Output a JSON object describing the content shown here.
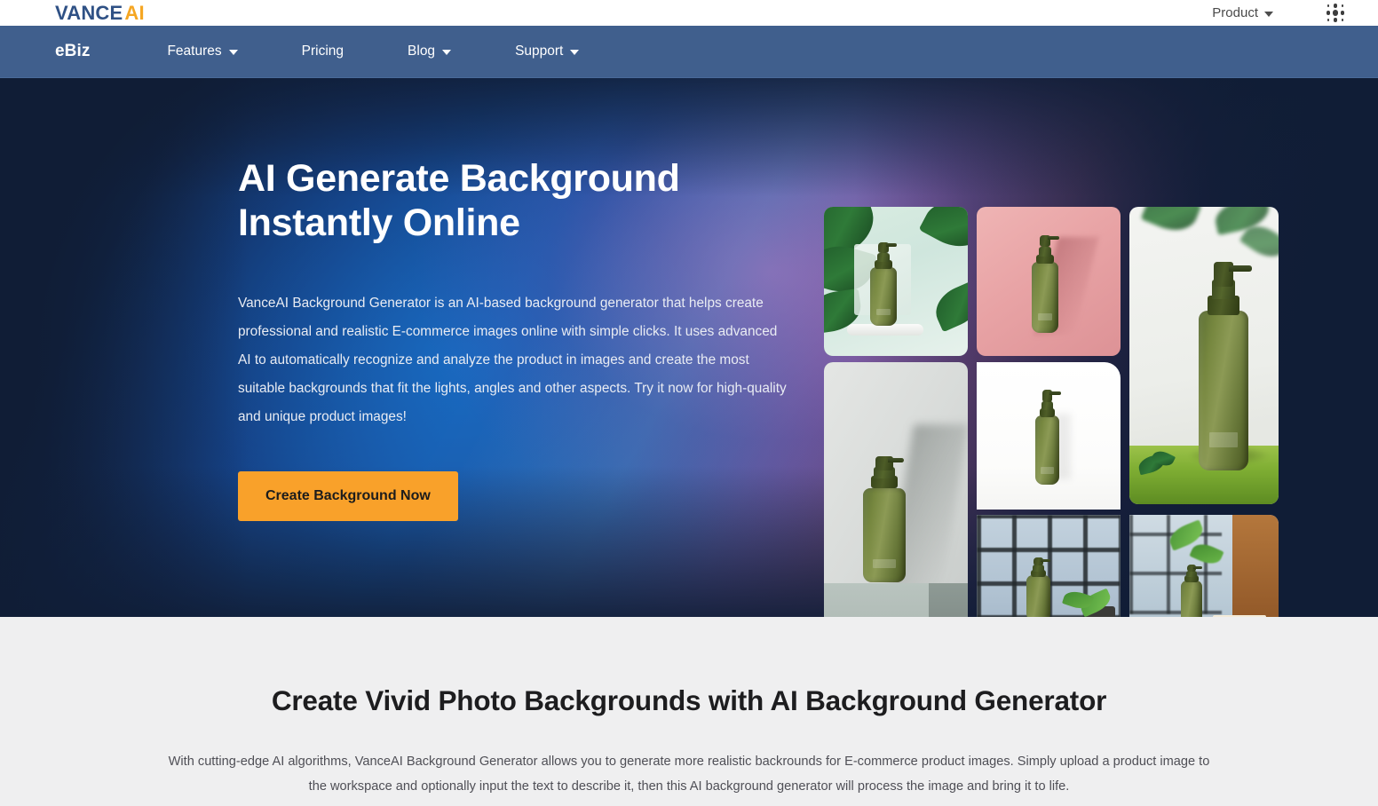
{
  "topbar": {
    "brand": {
      "primary": "VANCE",
      "accent": "AI"
    },
    "product_menu": {
      "label": "Product",
      "caret_icon": "chevron-down-icon"
    },
    "app_launcher_icon": "app-grid-icon"
  },
  "nav": {
    "logo": "eBiz",
    "items": [
      {
        "label": "Features",
        "has_dropdown": true
      },
      {
        "label": "Pricing",
        "has_dropdown": false
      },
      {
        "label": "Blog",
        "has_dropdown": true
      },
      {
        "label": "Support",
        "has_dropdown": true
      }
    ]
  },
  "hero": {
    "title_line1": "AI Generate Background",
    "title_line2": "Instantly Online",
    "description": "VanceAI Background Generator is an AI-based background generator that helps create professional and realistic E-commerce images online with simple clicks. It uses advanced AI to automatically recognize and analyze the product in images and create the most suitable backgrounds that fit the lights, angles and other aspects. Try it now for high-quality and unique product images!",
    "cta_label": "Create Background Now",
    "colors": {
      "background": "#101d36",
      "cta": "#f9a12a",
      "cta_text": "#1c1c1c",
      "beam_blue": "#1c60af",
      "beam_purple": "#9e5c96"
    },
    "gallery": {
      "alt_group": "green pump bottle product photos on generated backgrounds",
      "tiles": [
        {
          "id": "tile-monstera-leaves",
          "background": "mint green with monstera leaves and marble podium"
        },
        {
          "id": "tile-pink-wall",
          "background": "pink textured wall with hard shadow"
        },
        {
          "id": "tile-green-grass",
          "background": "white wall with green grass surface and mint sprig"
        },
        {
          "id": "tile-grey-pedestal",
          "background": "grey wall with concrete pedestal"
        },
        {
          "id": "tile-white-studio",
          "background": "plain white studio cutout"
        },
        {
          "id": "tile-window-plant",
          "background": "wooden table by window with potted plant"
        },
        {
          "id": "tile-window-towels",
          "background": "wooden table by window with folded towels"
        }
      ]
    }
  },
  "section": {
    "title": "Create Vivid Photo Backgrounds with AI Background Generator",
    "description": "With cutting-edge AI algorithms, VanceAI Background Generator allows you to generate more realistic backrounds for E-commerce product images. Simply upload a product image to the workspace and optionally input the text to describe it, then this AI background generator will process the image and bring it to life.",
    "colors": {
      "background": "#efeff0",
      "title": "#1d1d1f",
      "text": "#4f4f56"
    }
  }
}
